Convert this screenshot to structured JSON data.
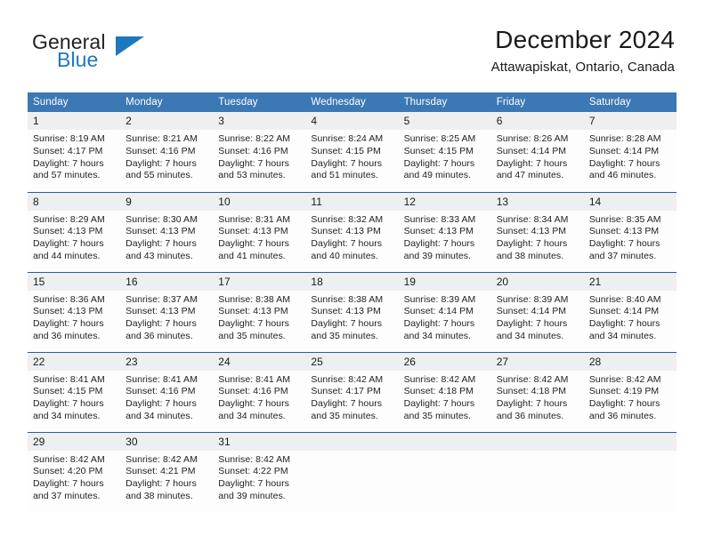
{
  "brand": {
    "name_part1": "General",
    "name_part2": "Blue",
    "triangle_color": "#1f77bd"
  },
  "header": {
    "title": "December 2024",
    "subtitle": "Attawapiskat, Ontario, Canada",
    "accent_color": "#3c78b4",
    "row_border_color": "#2a6099",
    "daynum_background": "#efefef"
  },
  "weekdays": [
    "Sunday",
    "Monday",
    "Tuesday",
    "Wednesday",
    "Thursday",
    "Friday",
    "Saturday"
  ],
  "labels": {
    "sunrise_prefix": "Sunrise:",
    "sunset_prefix": "Sunset:",
    "daylight_prefix": "Daylight:"
  },
  "weeks": [
    [
      {
        "day": "1",
        "l1": "Sunrise: 8:19 AM",
        "l2": "Sunset: 4:17 PM",
        "l3": "Daylight: 7 hours",
        "l4": "and 57 minutes."
      },
      {
        "day": "2",
        "l1": "Sunrise: 8:21 AM",
        "l2": "Sunset: 4:16 PM",
        "l3": "Daylight: 7 hours",
        "l4": "and 55 minutes."
      },
      {
        "day": "3",
        "l1": "Sunrise: 8:22 AM",
        "l2": "Sunset: 4:16 PM",
        "l3": "Daylight: 7 hours",
        "l4": "and 53 minutes."
      },
      {
        "day": "4",
        "l1": "Sunrise: 8:24 AM",
        "l2": "Sunset: 4:15 PM",
        "l3": "Daylight: 7 hours",
        "l4": "and 51 minutes."
      },
      {
        "day": "5",
        "l1": "Sunrise: 8:25 AM",
        "l2": "Sunset: 4:15 PM",
        "l3": "Daylight: 7 hours",
        "l4": "and 49 minutes."
      },
      {
        "day": "6",
        "l1": "Sunrise: 8:26 AM",
        "l2": "Sunset: 4:14 PM",
        "l3": "Daylight: 7 hours",
        "l4": "and 47 minutes."
      },
      {
        "day": "7",
        "l1": "Sunrise: 8:28 AM",
        "l2": "Sunset: 4:14 PM",
        "l3": "Daylight: 7 hours",
        "l4": "and 46 minutes."
      }
    ],
    [
      {
        "day": "8",
        "l1": "Sunrise: 8:29 AM",
        "l2": "Sunset: 4:13 PM",
        "l3": "Daylight: 7 hours",
        "l4": "and 44 minutes."
      },
      {
        "day": "9",
        "l1": "Sunrise: 8:30 AM",
        "l2": "Sunset: 4:13 PM",
        "l3": "Daylight: 7 hours",
        "l4": "and 43 minutes."
      },
      {
        "day": "10",
        "l1": "Sunrise: 8:31 AM",
        "l2": "Sunset: 4:13 PM",
        "l3": "Daylight: 7 hours",
        "l4": "and 41 minutes."
      },
      {
        "day": "11",
        "l1": "Sunrise: 8:32 AM",
        "l2": "Sunset: 4:13 PM",
        "l3": "Daylight: 7 hours",
        "l4": "and 40 minutes."
      },
      {
        "day": "12",
        "l1": "Sunrise: 8:33 AM",
        "l2": "Sunset: 4:13 PM",
        "l3": "Daylight: 7 hours",
        "l4": "and 39 minutes."
      },
      {
        "day": "13",
        "l1": "Sunrise: 8:34 AM",
        "l2": "Sunset: 4:13 PM",
        "l3": "Daylight: 7 hours",
        "l4": "and 38 minutes."
      },
      {
        "day": "14",
        "l1": "Sunrise: 8:35 AM",
        "l2": "Sunset: 4:13 PM",
        "l3": "Daylight: 7 hours",
        "l4": "and 37 minutes."
      }
    ],
    [
      {
        "day": "15",
        "l1": "Sunrise: 8:36 AM",
        "l2": "Sunset: 4:13 PM",
        "l3": "Daylight: 7 hours",
        "l4": "and 36 minutes."
      },
      {
        "day": "16",
        "l1": "Sunrise: 8:37 AM",
        "l2": "Sunset: 4:13 PM",
        "l3": "Daylight: 7 hours",
        "l4": "and 36 minutes."
      },
      {
        "day": "17",
        "l1": "Sunrise: 8:38 AM",
        "l2": "Sunset: 4:13 PM",
        "l3": "Daylight: 7 hours",
        "l4": "and 35 minutes."
      },
      {
        "day": "18",
        "l1": "Sunrise: 8:38 AM",
        "l2": "Sunset: 4:13 PM",
        "l3": "Daylight: 7 hours",
        "l4": "and 35 minutes."
      },
      {
        "day": "19",
        "l1": "Sunrise: 8:39 AM",
        "l2": "Sunset: 4:14 PM",
        "l3": "Daylight: 7 hours",
        "l4": "and 34 minutes."
      },
      {
        "day": "20",
        "l1": "Sunrise: 8:39 AM",
        "l2": "Sunset: 4:14 PM",
        "l3": "Daylight: 7 hours",
        "l4": "and 34 minutes."
      },
      {
        "day": "21",
        "l1": "Sunrise: 8:40 AM",
        "l2": "Sunset: 4:14 PM",
        "l3": "Daylight: 7 hours",
        "l4": "and 34 minutes."
      }
    ],
    [
      {
        "day": "22",
        "l1": "Sunrise: 8:41 AM",
        "l2": "Sunset: 4:15 PM",
        "l3": "Daylight: 7 hours",
        "l4": "and 34 minutes."
      },
      {
        "day": "23",
        "l1": "Sunrise: 8:41 AM",
        "l2": "Sunset: 4:16 PM",
        "l3": "Daylight: 7 hours",
        "l4": "and 34 minutes."
      },
      {
        "day": "24",
        "l1": "Sunrise: 8:41 AM",
        "l2": "Sunset: 4:16 PM",
        "l3": "Daylight: 7 hours",
        "l4": "and 34 minutes."
      },
      {
        "day": "25",
        "l1": "Sunrise: 8:42 AM",
        "l2": "Sunset: 4:17 PM",
        "l3": "Daylight: 7 hours",
        "l4": "and 35 minutes."
      },
      {
        "day": "26",
        "l1": "Sunrise: 8:42 AM",
        "l2": "Sunset: 4:18 PM",
        "l3": "Daylight: 7 hours",
        "l4": "and 35 minutes."
      },
      {
        "day": "27",
        "l1": "Sunrise: 8:42 AM",
        "l2": "Sunset: 4:18 PM",
        "l3": "Daylight: 7 hours",
        "l4": "and 36 minutes."
      },
      {
        "day": "28",
        "l1": "Sunrise: 8:42 AM",
        "l2": "Sunset: 4:19 PM",
        "l3": "Daylight: 7 hours",
        "l4": "and 36 minutes."
      }
    ],
    [
      {
        "day": "29",
        "l1": "Sunrise: 8:42 AM",
        "l2": "Sunset: 4:20 PM",
        "l3": "Daylight: 7 hours",
        "l4": "and 37 minutes."
      },
      {
        "day": "30",
        "l1": "Sunrise: 8:42 AM",
        "l2": "Sunset: 4:21 PM",
        "l3": "Daylight: 7 hours",
        "l4": "and 38 minutes."
      },
      {
        "day": "31",
        "l1": "Sunrise: 8:42 AM",
        "l2": "Sunset: 4:22 PM",
        "l3": "Daylight: 7 hours",
        "l4": "and 39 minutes."
      },
      {
        "day": "",
        "l1": "",
        "l2": "",
        "l3": "",
        "l4": ""
      },
      {
        "day": "",
        "l1": "",
        "l2": "",
        "l3": "",
        "l4": ""
      },
      {
        "day": "",
        "l1": "",
        "l2": "",
        "l3": "",
        "l4": ""
      },
      {
        "day": "",
        "l1": "",
        "l2": "",
        "l3": "",
        "l4": ""
      }
    ]
  ]
}
